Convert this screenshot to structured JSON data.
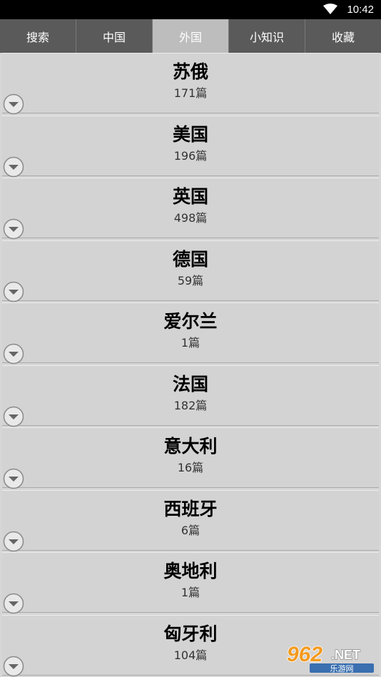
{
  "status_bar": {
    "time": "10:42"
  },
  "tabs": [
    {
      "label": "搜索",
      "active": false
    },
    {
      "label": "中国",
      "active": false
    },
    {
      "label": "外国",
      "active": true
    },
    {
      "label": "小知识",
      "active": false
    },
    {
      "label": "收藏",
      "active": false
    }
  ],
  "list": {
    "items": [
      {
        "title": "苏俄",
        "count": "171篇"
      },
      {
        "title": "美国",
        "count": "196篇"
      },
      {
        "title": "英国",
        "count": "498篇"
      },
      {
        "title": "德国",
        "count": "59篇"
      },
      {
        "title": "爱尔兰",
        "count": "1篇"
      },
      {
        "title": "法国",
        "count": "182篇"
      },
      {
        "title": "意大利",
        "count": "16篇"
      },
      {
        "title": "西班牙",
        "count": "6篇"
      },
      {
        "title": "奥地利",
        "count": "1篇"
      },
      {
        "title": "匈牙利",
        "count": "104篇"
      }
    ]
  },
  "watermark": {
    "brand": "962",
    "suffix": ".NET",
    "subtitle": "乐游网"
  },
  "colors": {
    "tab_bar": "#5a5a5a",
    "tab_active": "#bdbdbd",
    "list_bg": "#d6d6d6",
    "watermark_orange": "#f39a1e"
  }
}
